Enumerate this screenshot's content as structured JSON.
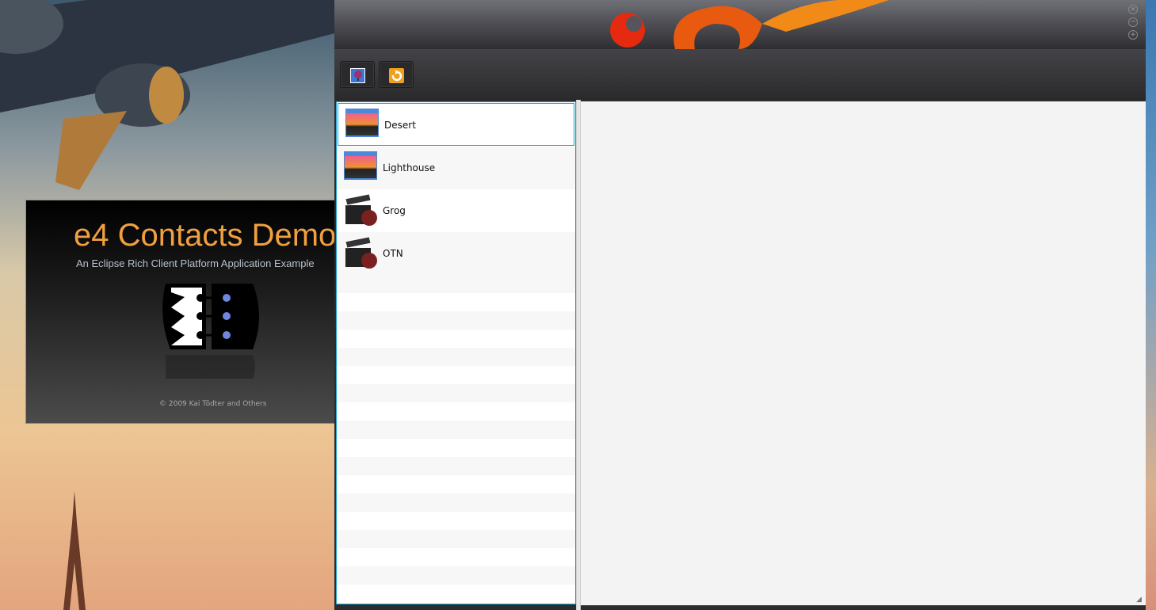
{
  "splash": {
    "title": "e4 Contacts Demo",
    "subtitle": "An Eclipse Rich Client Platform Application Example",
    "copyright": "© 2009 Kai Tödter and Others"
  },
  "window": {
    "controls": [
      {
        "name": "close",
        "glyph": "×"
      },
      {
        "name": "minimize",
        "glyph": "−"
      },
      {
        "name": "maximize",
        "glyph": "+"
      }
    ]
  },
  "toolbar": {
    "buttons": [
      {
        "name": "theme-image-button",
        "icon": "balloon-image-icon"
      },
      {
        "name": "refresh-button",
        "icon": "refresh-icon"
      }
    ]
  },
  "list": {
    "items": [
      {
        "label": "Desert",
        "icon": "sunset-image-icon",
        "selected": true
      },
      {
        "label": "Lighthouse",
        "icon": "sunset-image-icon",
        "selected": false
      },
      {
        "label": "Grog",
        "icon": "movie-clapper-icon",
        "selected": false
      },
      {
        "label": "OTN",
        "icon": "movie-clapper-icon",
        "selected": false
      }
    ]
  },
  "colors": {
    "accent": "#1aa0d0",
    "splash_title": "#f0a040"
  }
}
